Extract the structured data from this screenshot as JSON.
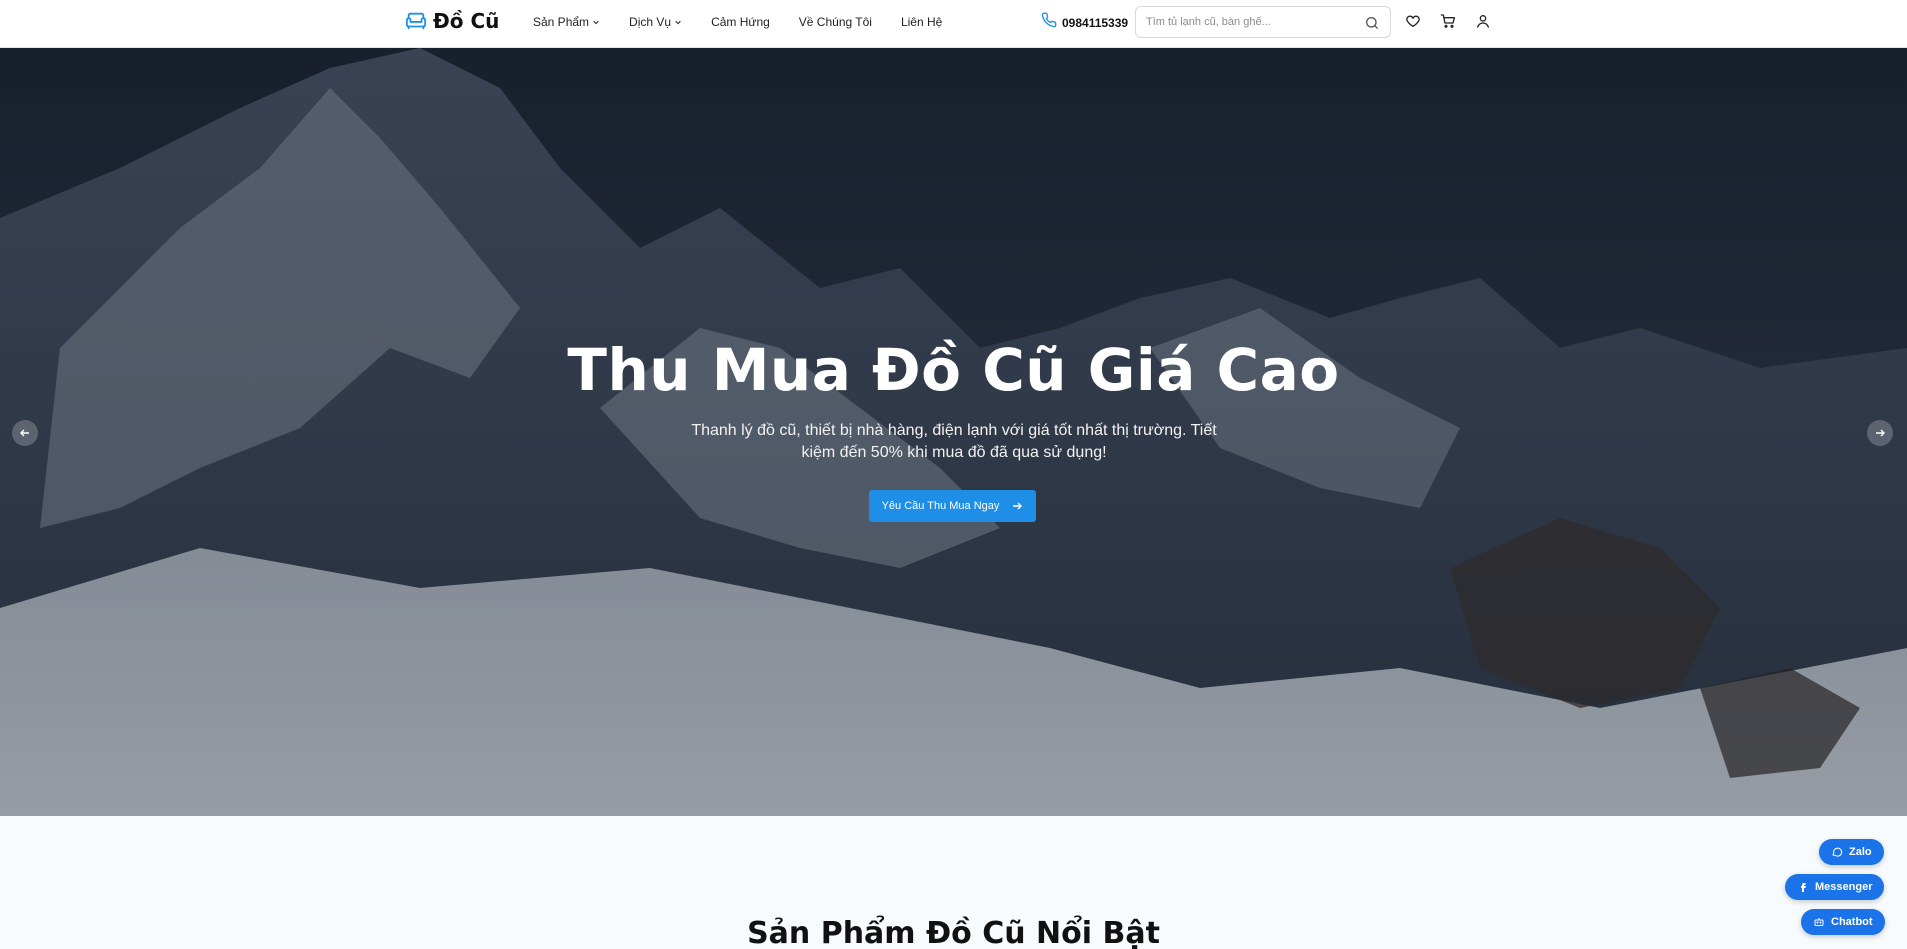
{
  "brand": {
    "name": "Đồ Cũ",
    "accent": "#1f8ee6"
  },
  "nav": {
    "items": [
      {
        "label": "Sản Phẩm",
        "dropdown": true
      },
      {
        "label": "Dịch Vụ",
        "dropdown": true
      },
      {
        "label": "Cảm Hứng",
        "dropdown": false
      },
      {
        "label": "Về Chúng Tôi",
        "dropdown": false
      },
      {
        "label": "Liên Hệ",
        "dropdown": false
      }
    ]
  },
  "contact": {
    "phone": "0984115339"
  },
  "search": {
    "placeholder": "Tìm tủ lạnh cũ, bàn ghế..."
  },
  "hero": {
    "title": "Thu Mua Đồ Cũ Giá Cao",
    "subtitle": "Thanh lý đồ cũ, thiết bị nhà hàng, điện lạnh với giá tốt nhất thị trường. Tiết kiệm đến 50% khi mua đồ đã qua sử dụng!",
    "cta_label": "Yêu Cầu Thu Mua Ngay"
  },
  "featured": {
    "title": "Sản Phẩm Đồ Cũ Nổi Bật"
  },
  "chat": {
    "zalo": "Zalo",
    "messenger": "Messenger",
    "chatbot": "Chatbot"
  }
}
